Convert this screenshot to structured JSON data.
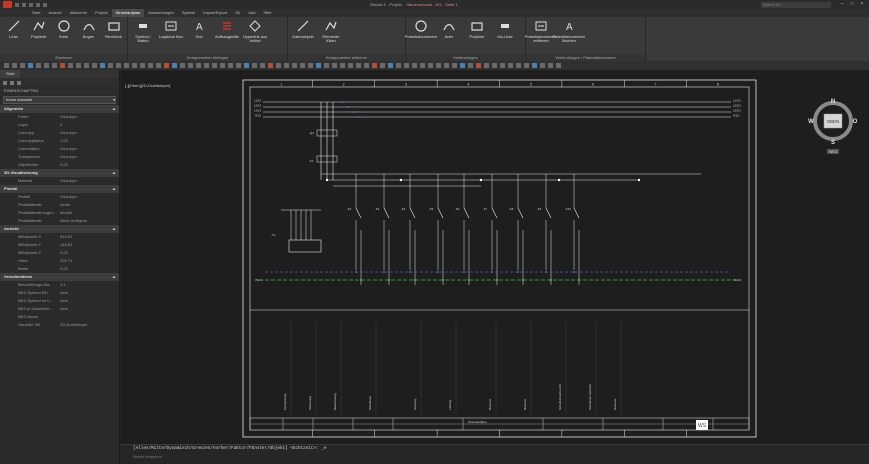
{
  "titlebar": {
    "title": "Wscad 1 - Projekt",
    "center_text": "Steuerschrank - W1 - Seite 1",
    "search_placeholder": "Online Hi..."
  },
  "menu_tabs": [
    "Start",
    "Ansicht",
    "Aktivieren",
    "Projekt",
    "Stromlaufplan",
    "Auswertungen",
    "System",
    "Import/Export",
    "3D",
    "Add",
    "Hilfe"
  ],
  "active_tab_index": 4,
  "ribbon": {
    "groups": [
      {
        "title": "Zeichnen",
        "buttons": [
          "Linie",
          "Polylinie",
          "Kreis",
          "Bogen",
          "Rechteck"
        ]
      },
      {
        "title": "Komponenten einfügen",
        "buttons": [
          "Symbol / Makro",
          "Logische Box",
          "Text",
          "Aufbaugeräte",
          "Hyperlink aus Artikel"
        ]
      },
      {
        "title": "Komponenten editieren",
        "buttons": [
          "Datenobjekt",
          "Elemente füllen"
        ]
      },
      {
        "title": "Verbindungen",
        "buttons": [
          "Potentialnummern",
          "Ader",
          "Polylinie",
          "Mo-Linie"
        ]
      },
      {
        "title": "Verbindungen / Potentialnummern",
        "buttons": [
          "Potentialnummern editieren",
          "Potentialnummern löschen"
        ]
      }
    ]
  },
  "left_panel": {
    "tabs": [
      "Start",
      ""
    ],
    "header": "EIGENSCHAFTEN",
    "selection": "Keine Auswahl",
    "sections": [
      {
        "title": "Allgemein",
        "rows": [
          [
            "Farbe",
            "VonLayer"
          ],
          [
            "Layer",
            "0"
          ],
          [
            "Linientyp",
            "VonLayer"
          ],
          [
            "Linientypfaktor",
            "1.00"
          ],
          [
            "Linienstärke",
            "VonLayer"
          ],
          [
            "Transparenz",
            "VonLayer"
          ],
          [
            "Objekthöhe",
            "0.00"
          ]
        ]
      },
      {
        "title": "3D-Visualisierung",
        "rows": [
          [
            "Material",
            "VonLayer"
          ]
        ]
      },
      {
        "title": "Plotstil",
        "rows": [
          [
            "Plotstil",
            "VonLayer"
          ],
          [
            "Plotstiltabelle",
            "Keine"
          ],
          [
            "Plotstiltabelle zugeo...",
            "Modell"
          ],
          [
            "Plotstiltabelle",
            "Nicht verfügbar"
          ]
        ]
      },
      {
        "title": "Ansicht",
        "rows": [
          [
            "Mittelpunkt X",
            "815.92"
          ],
          [
            "Mittelpunkt Y",
            "148.52"
          ],
          [
            "Mittelpunkt Z",
            "0.00"
          ],
          [
            "Höhe",
            "295.71"
          ],
          [
            "Breite",
            "0.00"
          ]
        ]
      },
      {
        "title": "Verschiedenes",
        "rows": [
          [
            "Beschriftungs-Ma...",
            "1:1"
          ],
          [
            "BKS-Symbol Ein",
            "Kein"
          ],
          [
            "BKS-Symbol im U...",
            "Kein"
          ],
          [
            "BKS je Ansichtsfe...",
            "Kein"
          ],
          [
            "BKS-Name",
            ""
          ],
          [
            "Visueller Stil",
            "2D-Drahtkörper"
          ]
        ]
      }
    ]
  },
  "document_tab": "[-][Oben][2D-Drahtkörper]",
  "drawing": {
    "column_numbers": [
      "1",
      "2",
      "3",
      "4",
      "5",
      "6",
      "7",
      "8"
    ],
    "rail_labels_left": [
      "L1/13",
      "L2/13",
      "L3/13",
      "N/13"
    ],
    "rail_labels_right": [
      "L1/2/1",
      "L2/2/1",
      "L3/2/1",
      "N/2/1"
    ],
    "pe_label_left": "PE/13",
    "pe_label_right": "PE/2/1",
    "main_switch": "-Q1",
    "fuse": "-F1",
    "transformer": "-T1",
    "breakers": [
      "-F2",
      "-F3",
      "-F4",
      "-F5",
      "-F6",
      "-F7",
      "-F8",
      "-F9",
      "-F10"
    ],
    "footer_texts": [
      "Einspeisung",
      "Steuerung",
      "Beleuchtung",
      "Steckdose",
      "Heizung",
      "Lüftung",
      "Reserve",
      "Reserve",
      "Schaltschrank Licht",
      "Steckdose Schrank",
      "Reserve"
    ],
    "title_block": {
      "label": "Stromlaufplan",
      "logo": "WS"
    }
  },
  "compass": {
    "n": "N",
    "s": "S",
    "w": "W",
    "e": "O",
    "center": "OBEN",
    "wcs": "WKS"
  },
  "command": {
    "line": "[Alles/Mitte/Dynamisch/Grenzen/Vorher/Faktor/FEnster/Objekt] <Echtzeit>: _e",
    "prompt": "Befehl eingeben"
  }
}
